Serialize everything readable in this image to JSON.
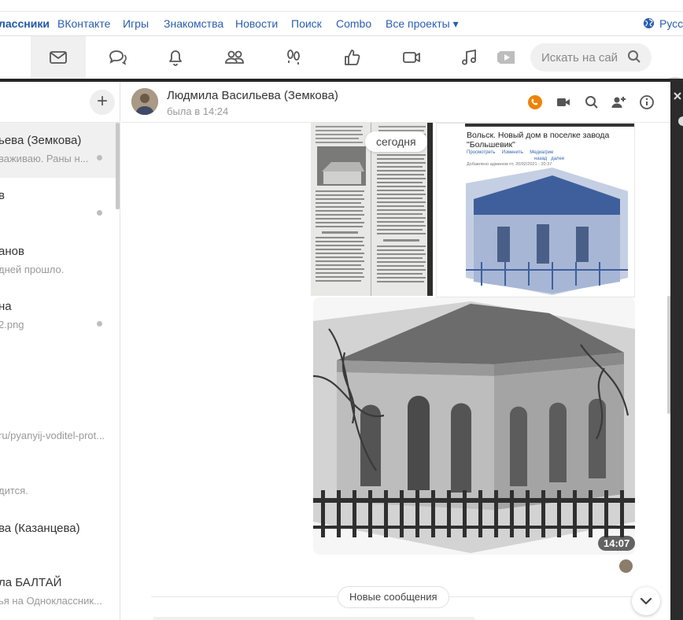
{
  "portal": {
    "links": [
      "лассники",
      "ВКонтакте",
      "Игры",
      "Знакомства",
      "Новости",
      "Поиск",
      "Combo",
      "Все проекты ▾"
    ],
    "language": "Русс"
  },
  "toolbar": {
    "icons": [
      "mail-icon",
      "chat-icon",
      "bell-icon",
      "friends-icon",
      "guests-icon",
      "like-icon",
      "video-icon",
      "music-icon",
      "video-player-icon"
    ],
    "search_placeholder": "Искать на сай"
  },
  "sidebar": {
    "new_label": "+",
    "dialogs": [
      {
        "name": "ьева (Земкова)",
        "preview": "важиваю. Раны н...",
        "unread": true,
        "selected": true
      },
      {
        "name": "в",
        "preview": "",
        "unread": true,
        "selected": false
      },
      {
        "name": "анов",
        "preview": "дней прошло.",
        "unread": false,
        "selected": false
      },
      {
        "name": "на",
        "preview": "2.png",
        "unread": true,
        "selected": false
      },
      {
        "name": "",
        "preview": "ru/pyanyij-voditel-prot...",
        "unread": false,
        "selected": false
      },
      {
        "name": "",
        "preview": "дится.",
        "unread": false,
        "selected": false
      },
      {
        "name": "ва (Казанцева)",
        "preview": "",
        "unread": false,
        "selected": false
      },
      {
        "name": "ла БАЛТАЙ",
        "preview": "ья на Одноклассник...",
        "unread": false,
        "selected": false
      }
    ]
  },
  "chat": {
    "name": "Людмила Васильева (Земкова)",
    "status": "была в 14:24",
    "today_label": "сегодня",
    "news_title": "Вольск. Новый дом в поселке завода \"Большевик\"",
    "news_tabs": [
      "Просмотреть",
      "Изменить",
      "Медиа/рие"
    ],
    "news_nav": [
      "назад",
      "далее"
    ],
    "news_meta": "Добавлено админом пт, 20/02/2021 - 20:37",
    "message_time": "14:07",
    "new_messages_label": "Новые сообщения"
  },
  "colors": {
    "accent_orange": "#ee8208",
    "link_blue": "#2a5db0",
    "dark_bar": "#262626"
  }
}
